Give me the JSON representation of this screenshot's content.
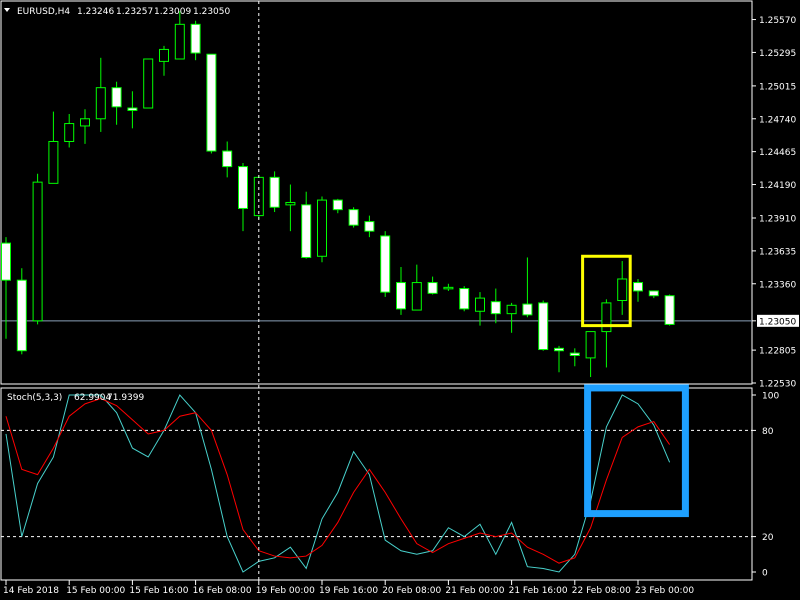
{
  "header": {
    "symbol": "EURUSD,H4",
    "open": "1.23246",
    "high": "1.23257",
    "low": "1.23009",
    "close": "1.23050"
  },
  "indicator": {
    "label": "Stoch(5,3,3)",
    "main_value": "62.9904",
    "signal_value": "71.9399"
  },
  "colors": {
    "background": "#000000",
    "bull_fill": "#000000",
    "bear_fill": "#ffffff",
    "wick": "#00ff00",
    "grid_frame": "#ffffff",
    "main_line": "#48d1cc",
    "signal_line": "#ff0000",
    "highlight_yellow": "#ffff00",
    "highlight_blue": "#1ea0ff"
  },
  "chart_data": [
    {
      "type": "candlestick",
      "title": "EURUSD,H4",
      "ylim": [
        1.2253,
        1.257
      ],
      "y_ticks": [
        "1.25570",
        "1.25295",
        "1.25015",
        "1.24740",
        "1.24465",
        "1.24190",
        "1.23910",
        "1.23635",
        "1.23360",
        "1.23050",
        "1.22805",
        "1.22530"
      ],
      "current_price": "1.23050",
      "x_ticks": [
        {
          "bar": 0,
          "label": "14 Feb 2018"
        },
        {
          "bar": 4,
          "label": "15 Feb 00:00"
        },
        {
          "bar": 8,
          "label": "15 Feb 16:00"
        },
        {
          "bar": 12,
          "label": "16 Feb 08:00"
        },
        {
          "bar": 16,
          "label": "19 Feb 00:00"
        },
        {
          "bar": 20,
          "label": "19 Feb 16:00"
        },
        {
          "bar": 24,
          "label": "20 Feb 08:00"
        },
        {
          "bar": 28,
          "label": "21 Feb 00:00"
        },
        {
          "bar": 32,
          "label": "21 Feb 16:00"
        },
        {
          "bar": 36,
          "label": "22 Feb 08:00"
        },
        {
          "bar": 40,
          "label": "23 Feb 00:00"
        }
      ],
      "crosshair_bar": 16,
      "candles": [
        {
          "o": 1.237,
          "h": 1.2375,
          "l": 1.229,
          "c": 1.2339
        },
        {
          "o": 1.2339,
          "h": 1.2349,
          "l": 1.2277,
          "c": 1.228
        },
        {
          "o": 1.2305,
          "h": 1.2428,
          "l": 1.2302,
          "c": 1.2421
        },
        {
          "o": 1.242,
          "h": 1.248,
          "l": 1.242,
          "c": 1.2455
        },
        {
          "o": 1.2455,
          "h": 1.2478,
          "l": 1.245,
          "c": 1.247
        },
        {
          "o": 1.2468,
          "h": 1.2482,
          "l": 1.2453,
          "c": 1.2474
        },
        {
          "o": 1.2474,
          "h": 1.2525,
          "l": 1.2463,
          "c": 1.25
        },
        {
          "o": 1.25,
          "h": 1.2505,
          "l": 1.2469,
          "c": 1.2484
        },
        {
          "o": 1.2483,
          "h": 1.2497,
          "l": 1.2466,
          "c": 1.2481
        },
        {
          "o": 1.2483,
          "h": 1.2524,
          "l": 1.2483,
          "c": 1.2524
        },
        {
          "o": 1.2522,
          "h": 1.2535,
          "l": 1.251,
          "c": 1.2532
        },
        {
          "o": 1.2524,
          "h": 1.2564,
          "l": 1.2524,
          "c": 1.2553
        },
        {
          "o": 1.2553,
          "h": 1.2556,
          "l": 1.2523,
          "c": 1.2529
        },
        {
          "o": 1.2528,
          "h": 1.2528,
          "l": 1.2445,
          "c": 1.2447
        },
        {
          "o": 1.2447,
          "h": 1.2455,
          "l": 1.2425,
          "c": 1.2434
        },
        {
          "o": 1.2434,
          "h": 1.2437,
          "l": 1.238,
          "c": 1.2399
        },
        {
          "o": 1.2393,
          "h": 1.2425,
          "l": 1.239,
          "c": 1.2425
        },
        {
          "o": 1.2425,
          "h": 1.243,
          "l": 1.2396,
          "c": 1.24
        },
        {
          "o": 1.2402,
          "h": 1.2419,
          "l": 1.238,
          "c": 1.2404
        },
        {
          "o": 1.2402,
          "h": 1.2413,
          "l": 1.2357,
          "c": 1.2358
        },
        {
          "o": 1.2359,
          "h": 1.2409,
          "l": 1.2354,
          "c": 1.2406
        },
        {
          "o": 1.2406,
          "h": 1.2407,
          "l": 1.2395,
          "c": 1.2398
        },
        {
          "o": 1.2398,
          "h": 1.24,
          "l": 1.2383,
          "c": 1.2385
        },
        {
          "o": 1.2388,
          "h": 1.2393,
          "l": 1.2375,
          "c": 1.238
        },
        {
          "o": 1.2376,
          "h": 1.238,
          "l": 1.2325,
          "c": 1.2329
        },
        {
          "o": 1.2337,
          "h": 1.235,
          "l": 1.231,
          "c": 1.2315
        },
        {
          "o": 1.2314,
          "h": 1.2352,
          "l": 1.2314,
          "c": 1.2337
        },
        {
          "o": 1.2337,
          "h": 1.2342,
          "l": 1.2327,
          "c": 1.2328
        },
        {
          "o": 1.2332,
          "h": 1.2336,
          "l": 1.233,
          "c": 1.2333
        },
        {
          "o": 1.2332,
          "h": 1.2334,
          "l": 1.2313,
          "c": 1.2315
        },
        {
          "o": 1.2313,
          "h": 1.2329,
          "l": 1.2301,
          "c": 1.2324
        },
        {
          "o": 1.2321,
          "h": 1.2332,
          "l": 1.2303,
          "c": 1.2311
        },
        {
          "o": 1.2311,
          "h": 1.232,
          "l": 1.2295,
          "c": 1.2318
        },
        {
          "o": 1.2319,
          "h": 1.2358,
          "l": 1.2308,
          "c": 1.231
        },
        {
          "o": 1.232,
          "h": 1.2322,
          "l": 1.228,
          "c": 1.2281
        },
        {
          "o": 1.2282,
          "h": 1.2284,
          "l": 1.2262,
          "c": 1.228
        },
        {
          "o": 1.2278,
          "h": 1.2282,
          "l": 1.2267,
          "c": 1.2276
        },
        {
          "o": 1.2274,
          "h": 1.2296,
          "l": 1.2258,
          "c": 1.2296
        },
        {
          "o": 1.2296,
          "h": 1.2323,
          "l": 1.2266,
          "c": 1.232
        },
        {
          "o": 1.2322,
          "h": 1.2355,
          "l": 1.231,
          "c": 1.234
        },
        {
          "o": 1.2337,
          "h": 1.234,
          "l": 1.2321,
          "c": 1.233
        },
        {
          "o": 1.233,
          "h": 1.233,
          "l": 1.2324,
          "c": 1.2326
        },
        {
          "o": 1.2326,
          "h": 1.2327,
          "l": 1.2301,
          "c": 1.2302
        }
      ],
      "highlight_box": {
        "from_bar": 37,
        "to_bar": 39,
        "from_price": 1.2301,
        "to_price": 1.2359
      }
    },
    {
      "type": "line",
      "title": "Stoch(5,3,3)",
      "ylim": [
        0,
        100
      ],
      "y_ticks": [
        "100",
        "80",
        "20",
        "0"
      ],
      "levels": [
        80,
        20
      ],
      "series": [
        {
          "name": "Main",
          "values": [
            78,
            20,
            50,
            65,
            100,
            100,
            100,
            90,
            70,
            65,
            80,
            100,
            90,
            58,
            20,
            0,
            6,
            8,
            14,
            2,
            30,
            45,
            68,
            55,
            18,
            12,
            10,
            12,
            25,
            20,
            27,
            10,
            28,
            3,
            2,
            0,
            10,
            40,
            82,
            100,
            95,
            83,
            62
          ]
        },
        {
          "name": "Signal",
          "values": [
            88,
            58,
            55,
            70,
            88,
            95,
            98,
            94,
            86,
            78,
            80,
            88,
            90,
            80,
            55,
            24,
            12,
            9,
            8,
            9,
            15,
            28,
            45,
            58,
            45,
            30,
            16,
            11,
            16,
            19,
            22,
            20,
            22,
            14,
            10,
            5,
            8,
            25,
            52,
            76,
            82,
            85,
            72
          ]
        }
      ],
      "highlight_box": {
        "from_bar": 37,
        "to_bar": 43,
        "from_value": 33,
        "to_value": 104
      }
    }
  ]
}
